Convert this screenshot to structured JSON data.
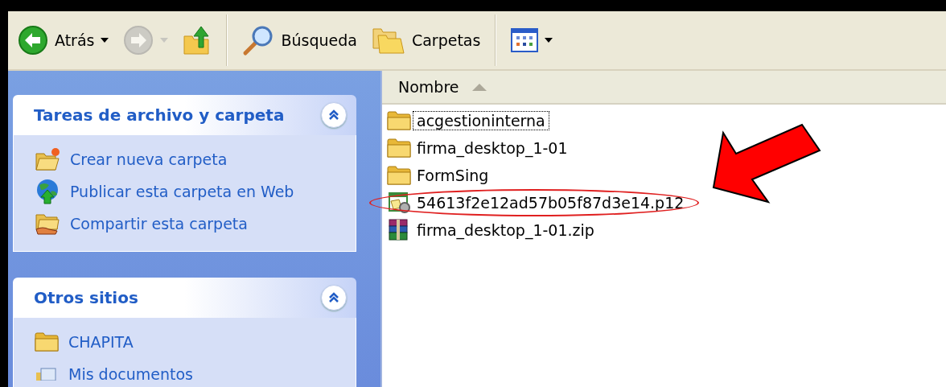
{
  "toolbar": {
    "buttons": [
      {
        "kind": "back",
        "label": "Atrás",
        "disabled": false
      },
      {
        "kind": "forward",
        "disabled": true
      },
      {
        "kind": "up",
        "disabled": false
      },
      {
        "kind": "search",
        "label": "Búsqueda",
        "disabled": false
      },
      {
        "kind": "folders",
        "label": "Carpetas",
        "disabled": false
      },
      {
        "kind": "views",
        "disabled": false
      }
    ]
  },
  "sidebar": {
    "panels": [
      {
        "title": "Tareas de archivo y carpeta",
        "expanded": true,
        "items": [
          {
            "kind": "new-folder",
            "label": "Crear nueva carpeta"
          },
          {
            "kind": "publish",
            "label": "Publicar esta carpeta en Web"
          },
          {
            "kind": "share",
            "label": "Compartir esta carpeta"
          }
        ]
      },
      {
        "title": "Otros sitios",
        "expanded": true,
        "items": [
          {
            "kind": "folder",
            "label": "CHAPITA"
          },
          {
            "kind": "documents",
            "label": "Mis documentos"
          }
        ]
      }
    ]
  },
  "file_list": {
    "columns": [
      {
        "label": "Nombre",
        "sorted": true
      }
    ],
    "files": [
      {
        "kind": "folder",
        "name": "acgestioninterna",
        "focused": true,
        "highlighted": false
      },
      {
        "kind": "folder",
        "name": "firma_desktop_1-01",
        "focused": false,
        "highlighted": false
      },
      {
        "kind": "folder",
        "name": "FormSing",
        "focused": false,
        "highlighted": false
      },
      {
        "kind": "certificate",
        "name": "54613f2e12ad57b05f87d3e14.p12",
        "focused": false,
        "highlighted": true
      },
      {
        "kind": "archive",
        "name": "firma_desktop_1-01.zip",
        "focused": false,
        "highlighted": false
      }
    ]
  }
}
